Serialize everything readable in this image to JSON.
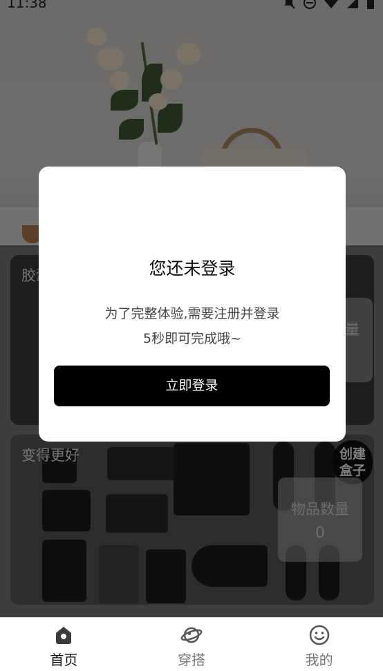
{
  "status_bar": {
    "time": "11:38",
    "icons": [
      "notifications-off-icon",
      "do-not-disturb-icon",
      "wifi-icon",
      "signal-icon",
      "battery-icon"
    ]
  },
  "cards": [
    {
      "title": "胶囊",
      "count_label": "物品数量",
      "count_value": ""
    },
    {
      "title": "变得更好",
      "create_button": "创建\n盒子",
      "count_label": "物品数量",
      "count_value": "0"
    }
  ],
  "login_dialog": {
    "title": "您还未登录",
    "message_line1": "为了完整体验,需要注册并登录",
    "message_line2": "5秒即可完成哦~",
    "button_label": "立即登录"
  },
  "tabbar": {
    "items": [
      {
        "label": "首页",
        "icon": "home-icon",
        "active": true
      },
      {
        "label": "穿搭",
        "icon": "planet-icon",
        "active": false
      },
      {
        "label": "我的",
        "icon": "smiley-icon",
        "active": false
      }
    ]
  },
  "colors": {
    "dialog_button": "#000000",
    "overlay": "rgba(0,0,0,0.5)",
    "tab_active": "#111111",
    "tab_inactive": "#777777"
  }
}
